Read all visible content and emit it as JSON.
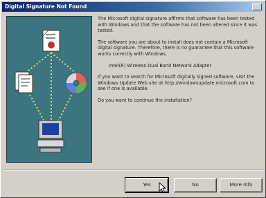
{
  "dialog": {
    "title": "Digital Signature Not Found"
  },
  "body": {
    "p1": "The Microsoft digital signature affirms that software has been tested with Windows and that the software has not been altered since it was tested.",
    "p2": "The software you are about to install does not contain a Microsoft digital signature. Therefore, there is no guarantee that this software works correctly with Windows.",
    "device": "Intel(R) Wireless Dual Band Network Adapter",
    "p3": "If you want to search for Microsoft digitally signed software, visit the Windows Update Web site at http://windowsupdate.microsoft.com to see if one is available.",
    "question": "Do you want to continue the installation?"
  },
  "buttons": {
    "yes": "Yes",
    "no": "No",
    "more_info": "More Info"
  },
  "icons": [
    "certificate-icon",
    "documents-icon",
    "cd-icon",
    "computer-icon"
  ]
}
